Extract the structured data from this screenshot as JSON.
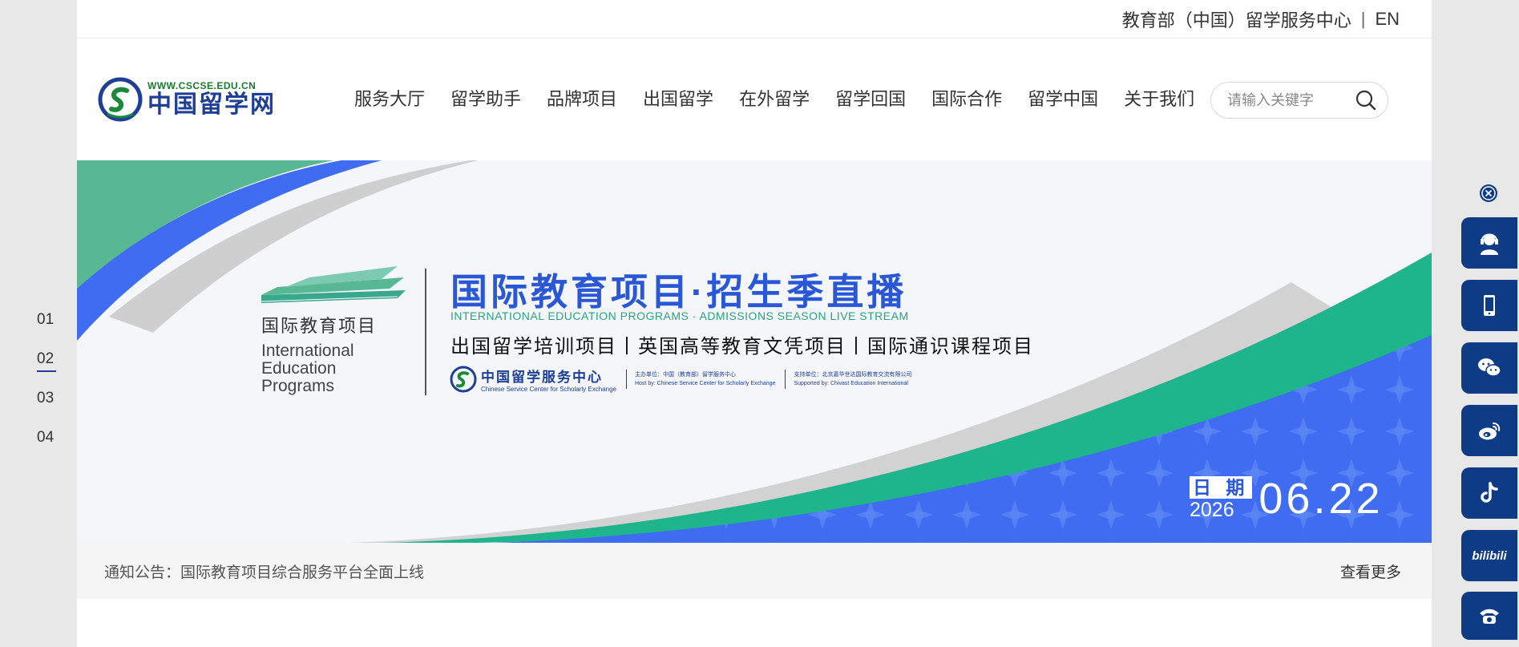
{
  "topbar": {
    "org_link": "教育部（中国）留学服务中心",
    "separator": "|",
    "lang": "EN"
  },
  "logo": {
    "domain": "WWW.CSCSE.EDU.CN",
    "name": "中国留学网"
  },
  "nav": {
    "items": [
      "服务大厅",
      "留学助手",
      "品牌项目",
      "出国留学",
      "在外留学",
      "留学回国",
      "国际合作",
      "留学中国",
      "关于我们"
    ]
  },
  "search": {
    "placeholder": "请输入关键字"
  },
  "banner": {
    "brand_title": "国际教育项目",
    "brand_en_1": "International",
    "brand_en_2": "Education",
    "brand_en_3": "Programs",
    "headline": "国际教育项目·招生季直播",
    "headline_en": "INTERNATIONAL EDUCATION PROGRAMS · ADMISSIONS SEASON LIVE STREAM",
    "programs": "出国留学培训项目丨英国高等教育文凭项目丨国际通识课程项目",
    "org_cn": "中国留学服务中心",
    "org_en": "Chinese Service Center for Scholarly Exchange",
    "host_cn": "主办单位：中国（教育部）留学服务中心",
    "host_en": "Host by: Chinese Service Center for Scholarly Exchange",
    "support_cn": "支持单位：北京嘉华世达国际教育交流有限公司",
    "support_en": "Supported by: Chivast Education International",
    "date_label": "日 期",
    "date_year": "2026",
    "date_day": "06.22",
    "colors": {
      "green": "#22b38a",
      "blue": "#3f6cf0",
      "gray": "#c9c9c9",
      "headline": "#2a57d6"
    }
  },
  "notice": {
    "text": "通知公告：国际教育项目综合服务平台全面上线",
    "more": "查看更多"
  },
  "slides": {
    "items": [
      "01",
      "02",
      "03",
      "04"
    ],
    "active_index": 1
  },
  "float_bar": {
    "items": [
      "customer-service-icon",
      "mobile-icon",
      "wechat-icon",
      "weibo-icon",
      "tiktok-icon",
      "bilibili-icon",
      "phone-icon"
    ],
    "bilibili_text": "bilibili",
    "color": "#0d3b86"
  }
}
